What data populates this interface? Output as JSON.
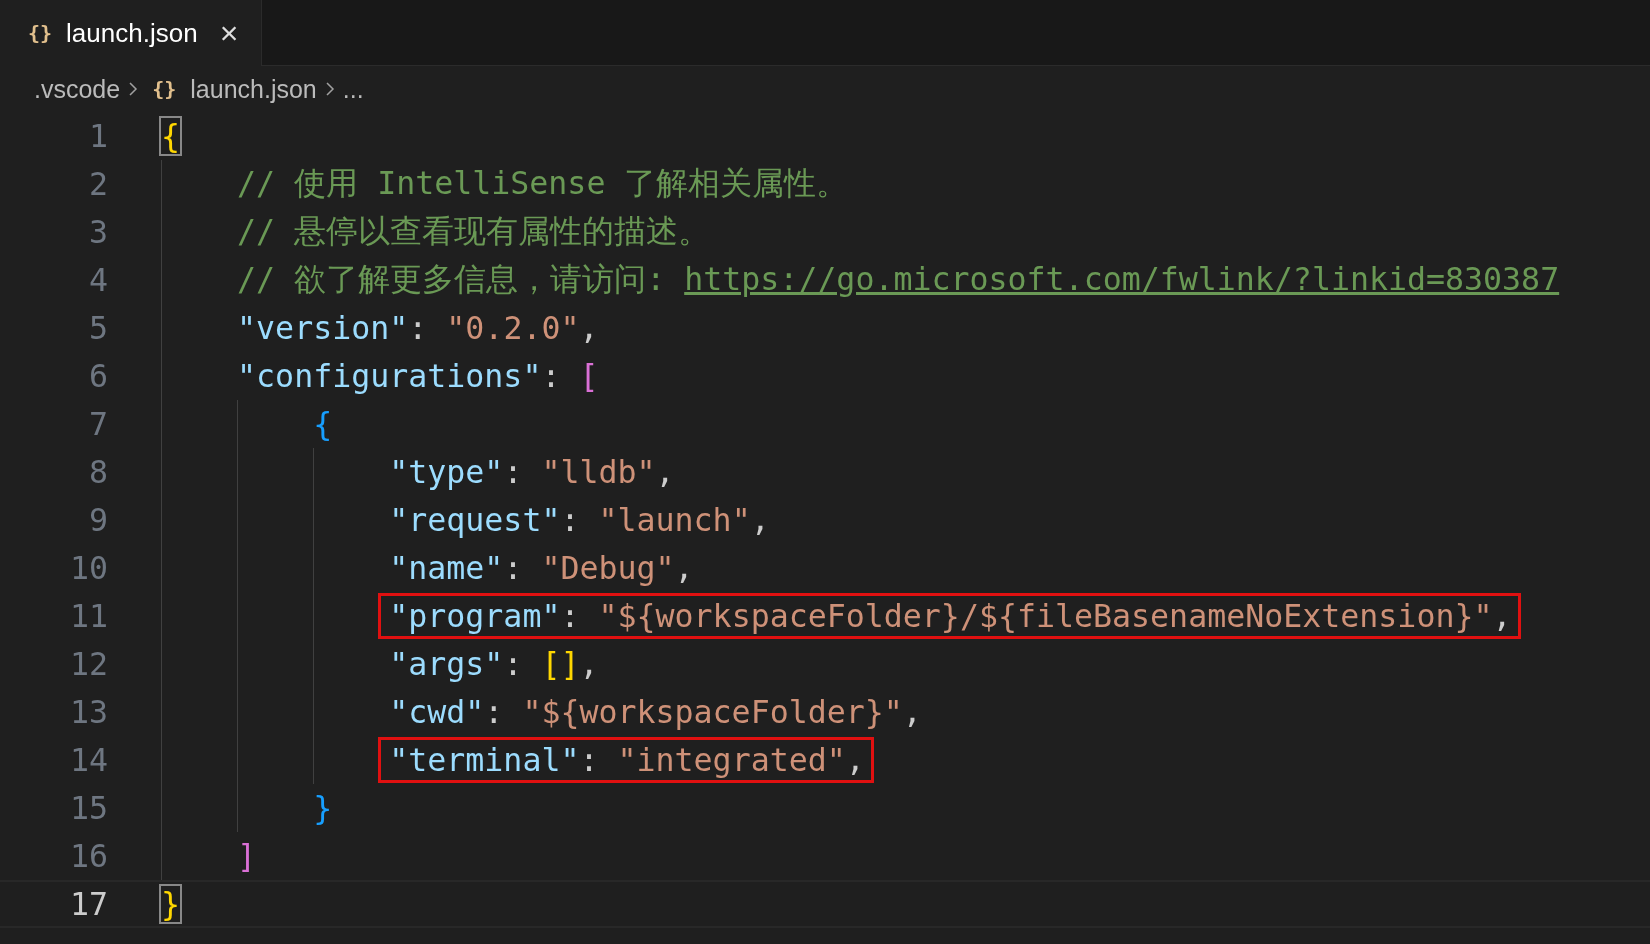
{
  "tabs": [
    {
      "icon": "{}",
      "label": "launch.json",
      "selected": true,
      "close": "×"
    }
  ],
  "breadcrumbs": [
    {
      "text": ".vscode"
    },
    {
      "icon": "{}",
      "text": "launch.json"
    },
    {
      "text": "..."
    }
  ],
  "lines": [
    {
      "number": "1",
      "current": false,
      "highlighted": false,
      "tokens": [
        {
          "kind": "brace1",
          "text": "{",
          "matched": true
        }
      ],
      "children": [
        {
          "number": "2",
          "current": false,
          "highlighted": false,
          "tokens": [
            {
              "kind": "comment",
              "text": "// 使用 IntelliSense 了解相关属性。"
            }
          ]
        },
        {
          "number": "3",
          "current": false,
          "highlighted": false,
          "tokens": [
            {
              "kind": "comment",
              "text": "// 悬停以查看现有属性的描述。"
            }
          ]
        },
        {
          "number": "4",
          "current": false,
          "highlighted": false,
          "tokens": [
            {
              "kind": "comment",
              "text": "// 欲了解更多信息，请访问: "
            },
            {
              "kind": "link",
              "text": "https://go.microsoft.com/fwlink/?linkid=830387"
            }
          ]
        },
        {
          "number": "5",
          "current": false,
          "highlighted": false,
          "tokens": [
            {
              "kind": "key",
              "text": "\"version\""
            },
            {
              "kind": "punct",
              "text": ": "
            },
            {
              "kind": "string",
              "text": "\"0.2.0\""
            },
            {
              "kind": "punct",
              "text": ","
            }
          ]
        },
        {
          "number": "6",
          "current": false,
          "highlighted": false,
          "tokens": [
            {
              "kind": "key",
              "text": "\"configurations\""
            },
            {
              "kind": "punct",
              "text": ": "
            },
            {
              "kind": "brace2",
              "text": "["
            }
          ],
          "children": [
            {
              "number": "7",
              "current": false,
              "highlighted": false,
              "tokens": [
                {
                  "kind": "brace3",
                  "text": "{"
                }
              ],
              "children": [
                {
                  "number": "8",
                  "current": false,
                  "highlighted": false,
                  "tokens": [
                    {
                      "kind": "key",
                      "text": "\"type\""
                    },
                    {
                      "kind": "punct",
                      "text": ": "
                    },
                    {
                      "kind": "string",
                      "text": "\"lldb\""
                    },
                    {
                      "kind": "punct",
                      "text": ","
                    }
                  ]
                },
                {
                  "number": "9",
                  "current": false,
                  "highlighted": false,
                  "tokens": [
                    {
                      "kind": "key",
                      "text": "\"request\""
                    },
                    {
                      "kind": "punct",
                      "text": ": "
                    },
                    {
                      "kind": "string",
                      "text": "\"launch\""
                    },
                    {
                      "kind": "punct",
                      "text": ","
                    }
                  ]
                },
                {
                  "number": "10",
                  "current": false,
                  "highlighted": false,
                  "tokens": [
                    {
                      "kind": "key",
                      "text": "\"name\""
                    },
                    {
                      "kind": "punct",
                      "text": ": "
                    },
                    {
                      "kind": "string",
                      "text": "\"Debug\""
                    },
                    {
                      "kind": "punct",
                      "text": ","
                    }
                  ]
                },
                {
                  "number": "11",
                  "current": false,
                  "highlighted": true,
                  "tokens": [
                    {
                      "kind": "key",
                      "text": "\"program\""
                    },
                    {
                      "kind": "punct",
                      "text": ": "
                    },
                    {
                      "kind": "string",
                      "text": "\"${workspaceFolder}/${fileBasenameNoExtension}\""
                    },
                    {
                      "kind": "punct",
                      "text": ","
                    }
                  ]
                },
                {
                  "number": "12",
                  "current": false,
                  "highlighted": false,
                  "tokens": [
                    {
                      "kind": "key",
                      "text": "\"args\""
                    },
                    {
                      "kind": "punct",
                      "text": ": "
                    },
                    {
                      "kind": "brace1",
                      "text": "[]"
                    },
                    {
                      "kind": "punct",
                      "text": ","
                    }
                  ]
                },
                {
                  "number": "13",
                  "current": false,
                  "highlighted": false,
                  "tokens": [
                    {
                      "kind": "key",
                      "text": "\"cwd\""
                    },
                    {
                      "kind": "punct",
                      "text": ": "
                    },
                    {
                      "kind": "string",
                      "text": "\"${workspaceFolder}\""
                    },
                    {
                      "kind": "punct",
                      "text": ","
                    }
                  ]
                },
                {
                  "number": "14",
                  "current": false,
                  "highlighted": true,
                  "tokens": [
                    {
                      "kind": "key",
                      "text": "\"terminal\""
                    },
                    {
                      "kind": "punct",
                      "text": ": "
                    },
                    {
                      "kind": "string",
                      "text": "\"integrated\""
                    },
                    {
                      "kind": "punct",
                      "text": ","
                    }
                  ]
                }
              ]
            },
            {
              "number": "15",
              "current": false,
              "highlighted": false,
              "tokens": [
                {
                  "kind": "brace3",
                  "text": "}"
                }
              ]
            }
          ]
        },
        {
          "number": "16",
          "current": false,
          "highlighted": false,
          "tokens": [
            {
              "kind": "brace2",
              "text": "]"
            }
          ]
        }
      ]
    },
    {
      "number": "17",
      "current": true,
      "highlighted": false,
      "tokens": [
        {
          "kind": "brace1",
          "text": "}",
          "matched": true
        }
      ]
    }
  ]
}
